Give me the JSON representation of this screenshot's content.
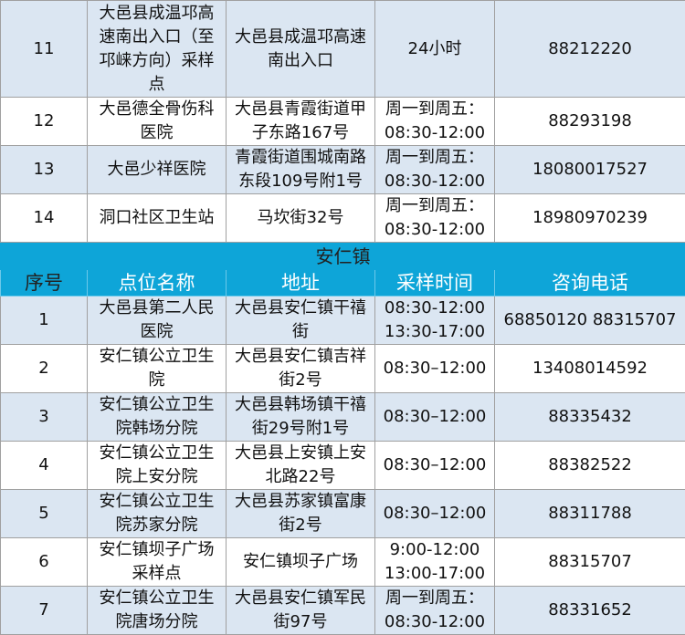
{
  "top_rows": [
    {
      "no": "11",
      "name": "大邑县成温邛高速南出入口（至邛崃方向）采样点",
      "addr": "大邑县成温邛高速南出入口",
      "time": "24小时",
      "phone": "88212220"
    },
    {
      "no": "12",
      "name": "大邑德全骨伤科医院",
      "addr": "大邑县青霞街道甲子东路167号",
      "time": "周一到周五：08:30-12:00",
      "phone": "88293198"
    },
    {
      "no": "13",
      "name": "大邑少祥医院",
      "addr": "青霞街道围城南路东段109号附1号",
      "time": "周一到周五：08:30-12:00",
      "phone": "18080017527"
    },
    {
      "no": "14",
      "name": "洞口社区卫生站",
      "addr": "马坎街32号",
      "time": "周一到周五：08:30-12:00",
      "phone": "18980970239"
    }
  ],
  "section_title": "安仁镇",
  "headers": {
    "no": "序号",
    "name": "点位名称",
    "addr": "地址",
    "time": "采样时间",
    "phone": "咨询电话"
  },
  "bottom_rows": [
    {
      "no": "1",
      "name": "大邑县第二人民医院",
      "addr": "大邑县安仁镇干禧街",
      "time": "08:30-12:00 13:30-17:00",
      "phone": "68850120 88315707"
    },
    {
      "no": "2",
      "name": "安仁镇公立卫生院",
      "addr": "大邑县安仁镇吉祥街2号",
      "time": "08:30–12:00",
      "phone": "13408014592"
    },
    {
      "no": "3",
      "name": "安仁镇公立卫生院韩场分院",
      "addr": "大邑县韩场镇干禧街29号附1号",
      "time": "08:30–12:00",
      "phone": "88335432"
    },
    {
      "no": "4",
      "name": "安仁镇公立卫生院上安分院",
      "addr": "大邑县上安镇上安北路22号",
      "time": "08:30–12:00",
      "phone": "88382522"
    },
    {
      "no": "5",
      "name": "安仁镇公立卫生院苏家分院",
      "addr": "大邑县苏家镇富康街2号",
      "time": "08:30–12:00",
      "phone": "88311788"
    },
    {
      "no": "6",
      "name": "安仁镇坝子广场采样点",
      "addr": "安仁镇坝子广场",
      "time": "9:00-12:00 13:00-17:00",
      "phone": "88315707"
    },
    {
      "no": "7",
      "name": "安仁镇公立卫生院唐场分院",
      "addr": "大邑县安仁镇军民街97号",
      "time": "周一到周五：08:30-12:00",
      "phone": "88331652"
    }
  ]
}
